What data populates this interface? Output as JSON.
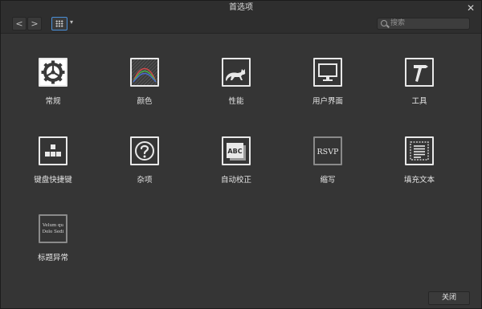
{
  "window": {
    "title": "首选项",
    "close_glyph": "✕"
  },
  "toolbar": {
    "back_glyph": "<",
    "forward_glyph": ">",
    "view_caret": "▾",
    "search_placeholder": "搜索"
  },
  "items": [
    {
      "label": "常规",
      "icon": "gear-icon"
    },
    {
      "label": "颜色",
      "icon": "color-icon"
    },
    {
      "label": "性能",
      "icon": "cat-icon"
    },
    {
      "label": "用户界面",
      "icon": "monitor-icon"
    },
    {
      "label": "工具",
      "icon": "hammer-icon"
    },
    {
      "label": "键盘快捷键",
      "icon": "keyboard-icon"
    },
    {
      "label": "杂项",
      "icon": "question-icon"
    },
    {
      "label": "自动校正",
      "icon": "abc-icon",
      "icon_text": "ABC"
    },
    {
      "label": "缩写",
      "icon": "rsvp-icon",
      "icon_text": "RSVP"
    },
    {
      "label": "填充文本",
      "icon": "text-frame-icon"
    },
    {
      "label": "标题异常",
      "icon": "title-text-icon",
      "icon_text_line1": "Velum qu",
      "icon_text_line2": "Dolo Sedi"
    }
  ],
  "footer": {
    "close_label": "关闭"
  }
}
